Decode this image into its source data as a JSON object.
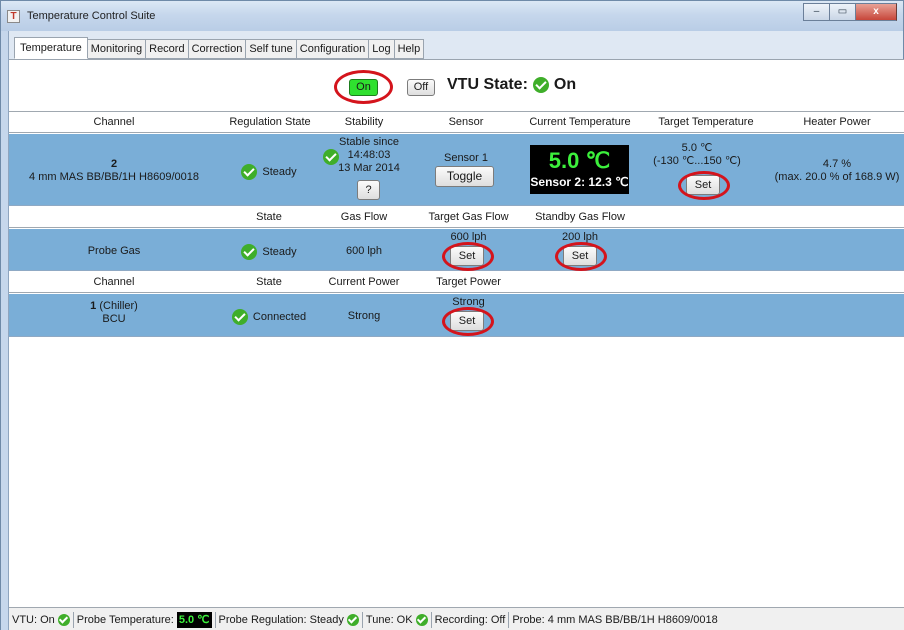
{
  "window": {
    "title": "Temperature Control Suite",
    "icon_letter": "T",
    "minimize": "–",
    "maximize": "▭",
    "close": "x"
  },
  "tabs": [
    "Temperature",
    "Monitoring",
    "Record",
    "Correction",
    "Self tune",
    "Configuration",
    "Log",
    "Help"
  ],
  "vtu": {
    "on_label": "On",
    "off_label": "Off",
    "state_label": "VTU State:",
    "state_value": "On"
  },
  "section1": {
    "headers": [
      "Channel",
      "Regulation State",
      "Stability",
      "Sensor",
      "Current Temperature",
      "Target Temperature",
      "Heater Power"
    ],
    "channel_number": "2",
    "channel_name": "4 mm MAS BB/BB/1H H8609/0018",
    "regulation_state": "Steady",
    "stability": {
      "line1": "Stable since",
      "line2": "14:48:03",
      "line3": "13 Mar 2014",
      "help_label": "?"
    },
    "sensor": {
      "name": "Sensor 1",
      "toggle_label": "Toggle"
    },
    "current_temperature": {
      "value": "5.0 ℃",
      "sensor2": "Sensor 2: 12.3 ℃"
    },
    "target_temperature": {
      "value": "5.0 ℃",
      "range": "(-130 ℃...150 ℃)",
      "set_label": "Set"
    },
    "heater_power": {
      "value": "4.7 %",
      "max": "(max. 20.0 % of 168.9 W)"
    }
  },
  "section2": {
    "headers": [
      "State",
      "Gas Flow",
      "Target Gas Flow",
      "Standby Gas Flow"
    ],
    "name": "Probe Gas",
    "state": "Steady",
    "gas_flow": "600 lph",
    "target_gas_flow": "600 lph",
    "target_set_label": "Set",
    "standby_gas_flow": "200 lph",
    "standby_set_label": "Set"
  },
  "section3": {
    "headers": [
      "Channel",
      "State",
      "Current Power",
      "Target Power"
    ],
    "channel_number": "1",
    "channel_type": "(Chiller)",
    "channel_name": "BCU",
    "state": "Connected",
    "current_power": "Strong",
    "target_power": "Strong",
    "set_label": "Set"
  },
  "statusbar": {
    "vtu": "VTU: On",
    "probe_temp_label": "Probe Temperature:",
    "probe_temp_value": "5.0 ℃",
    "probe_regulation": "Probe Regulation: Steady",
    "tune": "Tune: OK",
    "recording": "Recording: Off",
    "probe": "Probe: 4 mm MAS BB/BB/1H H8609/0018"
  },
  "colors": {
    "row_blue": "#7aaed7",
    "highlight_red": "#d4141c",
    "on_green": "#2fe02f",
    "check_green": "#3fae2a"
  }
}
